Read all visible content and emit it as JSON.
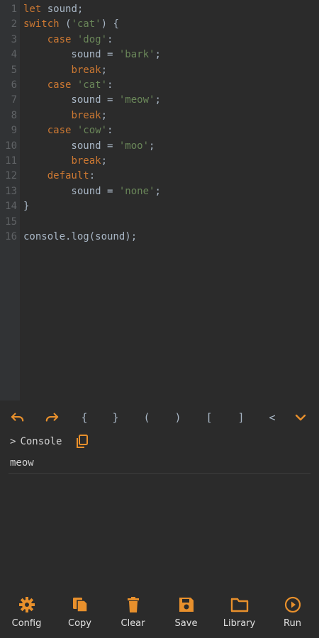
{
  "editor": {
    "lines": [
      {
        "n": "1",
        "parts": [
          [
            "kw",
            "let"
          ],
          [
            "plain",
            " sound;"
          ]
        ]
      },
      {
        "n": "2",
        "parts": [
          [
            "kw",
            "switch"
          ],
          [
            "plain",
            " ("
          ],
          [
            "str",
            "'cat'"
          ],
          [
            "plain",
            ") {"
          ]
        ]
      },
      {
        "n": "3",
        "parts": [
          [
            "plain",
            "    "
          ],
          [
            "kw",
            "case"
          ],
          [
            "plain",
            " "
          ],
          [
            "str",
            "'dog'"
          ],
          [
            "plain",
            ":"
          ]
        ]
      },
      {
        "n": "4",
        "parts": [
          [
            "plain",
            "        sound = "
          ],
          [
            "str",
            "'bark'"
          ],
          [
            "plain",
            ";"
          ]
        ]
      },
      {
        "n": "5",
        "parts": [
          [
            "plain",
            "        "
          ],
          [
            "kw",
            "break"
          ],
          [
            "plain",
            ";"
          ]
        ]
      },
      {
        "n": "6",
        "parts": [
          [
            "plain",
            "    "
          ],
          [
            "kw",
            "case"
          ],
          [
            "plain",
            " "
          ],
          [
            "str",
            "'cat'"
          ],
          [
            "plain",
            ":"
          ]
        ]
      },
      {
        "n": "7",
        "parts": [
          [
            "plain",
            "        sound = "
          ],
          [
            "str",
            "'meow'"
          ],
          [
            "plain",
            ";"
          ]
        ]
      },
      {
        "n": "8",
        "parts": [
          [
            "plain",
            "        "
          ],
          [
            "kw",
            "break"
          ],
          [
            "plain",
            ";"
          ]
        ]
      },
      {
        "n": "9",
        "parts": [
          [
            "plain",
            "    "
          ],
          [
            "kw",
            "case"
          ],
          [
            "plain",
            " "
          ],
          [
            "str",
            "'cow'"
          ],
          [
            "plain",
            ":"
          ]
        ]
      },
      {
        "n": "10",
        "parts": [
          [
            "plain",
            "        sound = "
          ],
          [
            "str",
            "'moo'"
          ],
          [
            "plain",
            ";"
          ]
        ]
      },
      {
        "n": "11",
        "parts": [
          [
            "plain",
            "        "
          ],
          [
            "kw",
            "break"
          ],
          [
            "plain",
            ";"
          ]
        ]
      },
      {
        "n": "12",
        "parts": [
          [
            "plain",
            "    "
          ],
          [
            "kw",
            "default"
          ],
          [
            "plain",
            ":"
          ]
        ]
      },
      {
        "n": "13",
        "parts": [
          [
            "plain",
            "        sound = "
          ],
          [
            "str",
            "'none'"
          ],
          [
            "plain",
            ";"
          ]
        ]
      },
      {
        "n": "14",
        "parts": [
          [
            "plain",
            "}"
          ]
        ]
      },
      {
        "n": "15",
        "parts": []
      },
      {
        "n": "16",
        "parts": [
          [
            "plain",
            "console.log(sound);"
          ]
        ]
      }
    ]
  },
  "toolbar": {
    "undo_icon": "undo-icon",
    "redo_icon": "redo-icon",
    "keys": [
      "{",
      "}",
      "(",
      ")",
      "[",
      "]",
      "<"
    ],
    "collapse_icon": "chevron-down-icon"
  },
  "console": {
    "prefix": ">",
    "title": "Console",
    "copy_icon": "copy-icon",
    "output": "meow"
  },
  "nav": {
    "items": [
      {
        "label": "Config",
        "icon": "gear-icon"
      },
      {
        "label": "Copy",
        "icon": "copy-icon"
      },
      {
        "label": "Clear",
        "icon": "trash-icon"
      },
      {
        "label": "Save",
        "icon": "save-icon"
      },
      {
        "label": "Library",
        "icon": "folder-icon"
      },
      {
        "label": "Run",
        "icon": "play-icon"
      }
    ]
  },
  "colors": {
    "accent": "#e8902c",
    "background": "#2b2b2b",
    "gutter": "#313335",
    "keyword": "#cc7832",
    "string": "#6a8759",
    "text": "#a9b7c6"
  }
}
